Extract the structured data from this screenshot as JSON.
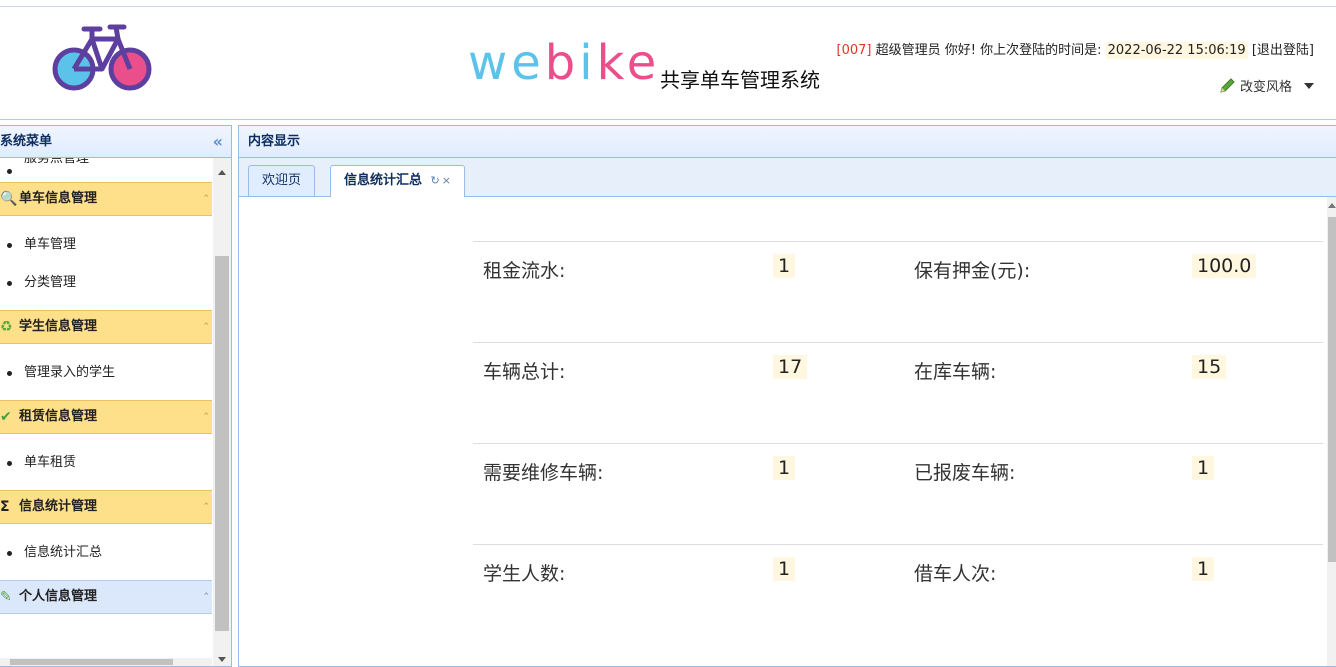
{
  "header": {
    "logo_word_part1": "we",
    "logo_word_part2": "b",
    "logo_word_part3": "i",
    "logo_word_part4": "ke",
    "logo_subtitle": "共享单车管理系统",
    "user_code": "[007]",
    "user_greeting": "超级管理员 你好! 你上次登陆的时间是:",
    "last_login": "2022-06-22 15:06:19",
    "logout": "[退出登陆]",
    "style_switch": "改变风格",
    "colors": {
      "logo_blue": "#5bc3ea",
      "logo_pink": "#ea4f8c"
    }
  },
  "sidebar": {
    "title": "系统菜单",
    "collapse_icon": "double-chevron-left-icon",
    "top_partial_item": "服务点管理",
    "groups": [
      {
        "title": "单车信息管理",
        "icon": "search-icon",
        "items": [
          "单车管理",
          "分类管理"
        ]
      },
      {
        "title": "学生信息管理",
        "icon": "refresh-icon",
        "items": [
          "管理录入的学生"
        ]
      },
      {
        "title": "租赁信息管理",
        "icon": "check-icon",
        "items": [
          "单车租赁"
        ]
      },
      {
        "title": "信息统计管理",
        "icon": "sigma-icon",
        "items": [
          "信息统计汇总"
        ]
      },
      {
        "title": "个人信息管理",
        "icon": "pencil-icon",
        "items": []
      }
    ]
  },
  "main": {
    "title": "内容显示",
    "tabs": [
      {
        "label": "欢迎页",
        "active": false
      },
      {
        "label": "信息统计汇总",
        "active": true,
        "close": "×",
        "refresh": "↻"
      }
    ],
    "stats": [
      {
        "label1": "租金流水:",
        "value1": "1",
        "label2": "保有押金(元):",
        "value2": "100.0"
      },
      {
        "label1": "车辆总计:",
        "value1": "17",
        "label2": "在库车辆:",
        "value2": "15"
      },
      {
        "label1": "需要维修车辆:",
        "value1": "1",
        "label2": "已报废车辆:",
        "value2": "1"
      },
      {
        "label1": "学生人数:",
        "value1": "1",
        "label2": "借车人次:",
        "value2": "1"
      }
    ]
  }
}
